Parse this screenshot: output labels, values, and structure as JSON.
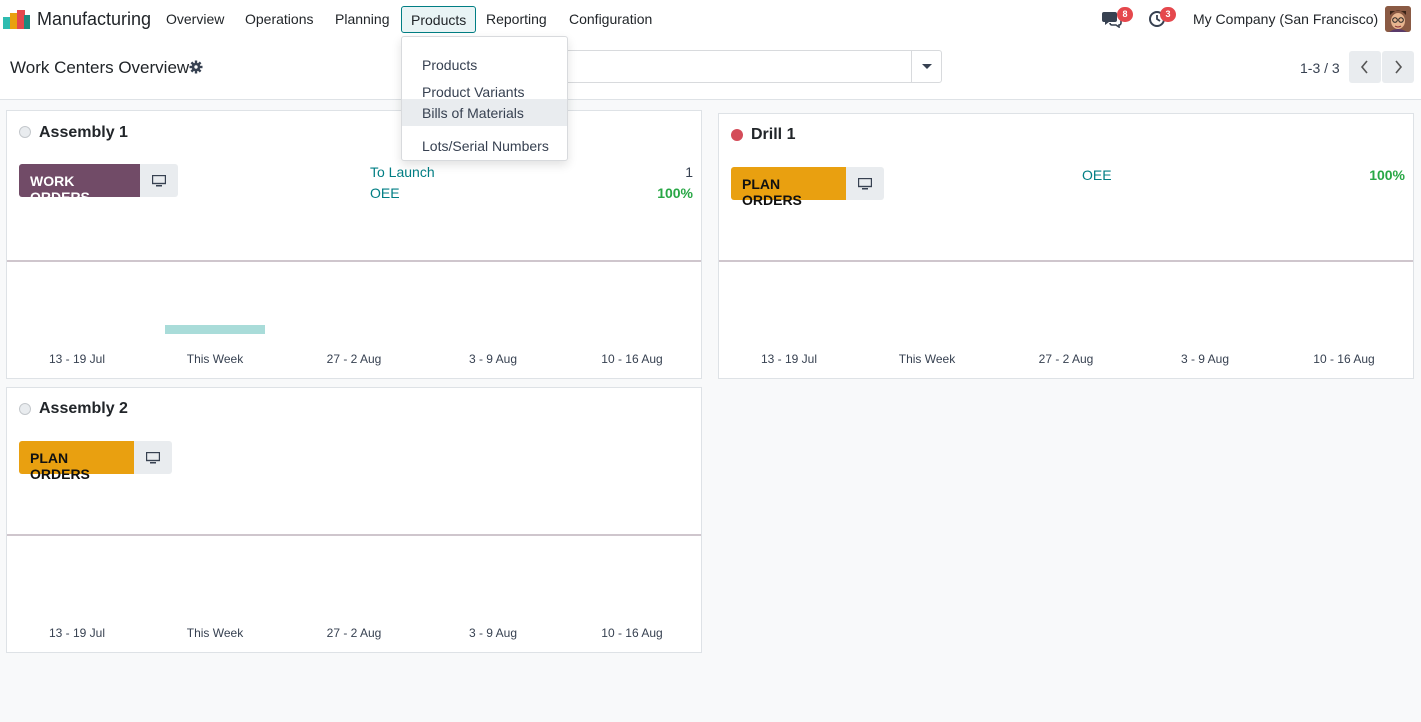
{
  "app": {
    "name": "Manufacturing",
    "logo_icon": "manufacturing-logo-icon"
  },
  "menu": [
    {
      "label": "Overview"
    },
    {
      "label": "Operations"
    },
    {
      "label": "Planning"
    },
    {
      "label": "Products",
      "active": true
    },
    {
      "label": "Reporting"
    },
    {
      "label": "Configuration"
    }
  ],
  "systray": {
    "messages_badge": "8",
    "activities_badge": "3",
    "company": "My Company (San Francisco)"
  },
  "control_panel": {
    "title": "Work Centers Overview",
    "pager": "1-3 / 3"
  },
  "dropdown": {
    "items": [
      {
        "label": "Products"
      },
      {
        "label": "Product Variants"
      },
      {
        "label": "Bills of Materials",
        "highlighted": true
      },
      {
        "label": "Lots/Serial Numbers"
      }
    ]
  },
  "colors": {
    "brand": "#714b67",
    "accent": "#017e84",
    "plan_button": "#e9a010",
    "good": "#28a745",
    "blocked": "#d44c59"
  },
  "cards": [
    {
      "name": "Assembly 1",
      "status": "idle",
      "primary_button": "WORK ORDERS",
      "stats": [
        {
          "label": "To Launch",
          "value": "1"
        },
        {
          "label": "OEE",
          "value": "100%"
        }
      ],
      "weeks": [
        "13 - 19 Jul",
        "This Week",
        "27 - 2 Aug",
        "3 - 9 Aug",
        "10 - 16 Aug"
      ],
      "load": [
        0,
        1,
        0,
        0,
        0
      ]
    },
    {
      "name": "Drill 1",
      "status": "blocked",
      "primary_button": "PLAN ORDERS",
      "stats": [
        {
          "label": "OEE",
          "value": "100%"
        }
      ],
      "weeks": [
        "13 - 19 Jul",
        "This Week",
        "27 - 2 Aug",
        "3 - 9 Aug",
        "10 - 16 Aug"
      ],
      "load": [
        0,
        0,
        0,
        0,
        0
      ]
    },
    {
      "name": "Assembly 2",
      "status": "idle",
      "primary_button": "PLAN ORDERS",
      "stats": [],
      "weeks": [
        "13 - 19 Jul",
        "This Week",
        "27 - 2 Aug",
        "3 - 9 Aug",
        "10 - 16 Aug"
      ],
      "load": [
        0,
        0,
        0,
        0,
        0
      ]
    }
  ]
}
